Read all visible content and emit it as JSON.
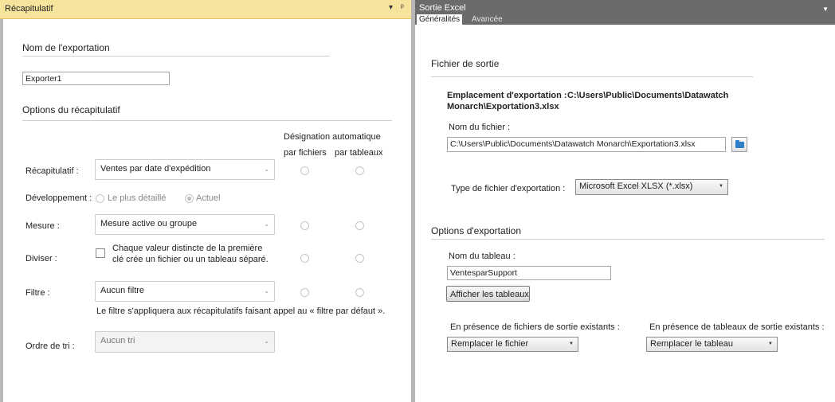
{
  "left_panel": {
    "header_title": "Récapitulatif",
    "header_buttons": [
      "▾",
      "ᵖ"
    ],
    "export_name_section": "Nom de l'exportation",
    "export_name_value": "Exporter1",
    "summary_options_section": "Options du récapitulatif",
    "auto_designation_header": "Désignation automatique",
    "col_by_files": "par fichiers",
    "col_by_tables": "par tableaux",
    "recap_label": "Récapitulatif :",
    "recap_value": "Ventes par date d'expédition",
    "development_label": "Développement :",
    "dev_option_most_detailed": "Le plus détaillé",
    "dev_option_current": "Actuel",
    "measure_label": "Mesure :",
    "measure_value": "Mesure active ou groupe",
    "divide_label": "Diviser :",
    "divide_text_line1": "Chaque valeur distincte de la première",
    "divide_text_line2": "clé crée un fichier ou un tableau séparé.",
    "filter_label": "Filtre :",
    "filter_value": "Aucun filtre",
    "filter_note": "Le filtre s'appliquera aux récapitulatifs faisant appel au « filtre par défaut ».",
    "sort_label": "Ordre de tri :",
    "sort_value": "Aucun tri"
  },
  "right_panel": {
    "header_title": "Sortie Excel",
    "tabs": [
      "Généralités",
      "Avancée"
    ],
    "output_file_section": "Fichier de sortie",
    "export_location_label": "Emplacement d'exportation :",
    "export_location_value_line1": "C:\\Users\\Public\\Documents\\Datawatch",
    "export_location_value_line2": "Monarch\\Exportation3.xlsx",
    "file_name_label": "Nom du fichier :",
    "file_name_value": "C:\\Users\\Public\\Documents\\Datawatch Monarch\\Exportation3.xlsx",
    "export_type_label": "Type de fichier d'exportation :",
    "export_type_value": "Microsoft Excel XLSX (*.xlsx)",
    "export_options_section": "Options d'exportation",
    "table_name_label": "Nom du tableau :",
    "table_name_value": "VentesparSupport",
    "show_tables_button": "Afficher les tableaux",
    "existing_files_label": "En présence de fichiers de sortie existants :",
    "existing_files_value": "Remplacer le fichier",
    "existing_tables_label": "En présence de tableaux de sortie existants :",
    "existing_tables_value": "Remplacer le tableau"
  },
  "icons": {
    "combo_arrow": "⌄",
    "dropdown_arrow": "▼",
    "header_chevron": "▼"
  },
  "colors": {
    "left_header_bg": "#f6e39c",
    "right_header_bg": "#6b6b6b",
    "folder_icon": "#2e7fc8"
  }
}
